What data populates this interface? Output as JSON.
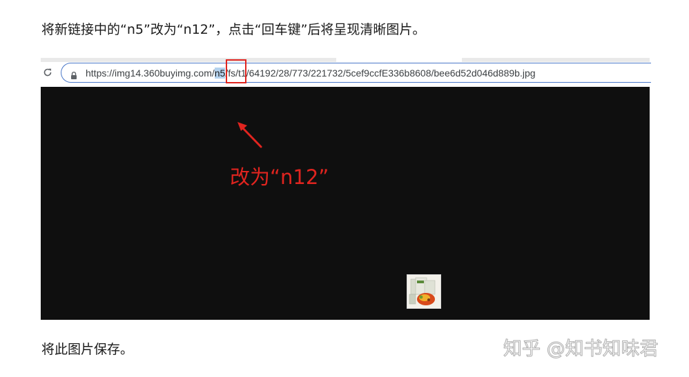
{
  "article": {
    "instruction_top": "将新链接中的“n5”改为“n12”，点击“回车键”后将呈现清晰图片。",
    "instruction_bottom": "将此图片保存。"
  },
  "browser": {
    "url_prefix": "https://img14.360buyimg.com/",
    "url_highlight": "n5",
    "url_suffix": "/fs/t1/64192/28/773/221732/5cef9ccfE336b8608/bee6d52d046d889b.jpg",
    "icons": [
      "reload-icon",
      "lock-icon"
    ]
  },
  "annotation": {
    "label": "改为“n12”",
    "color": "#e0241f"
  },
  "watermark": {
    "text": "知乎 @知书知味君"
  },
  "colors": {
    "viewport_background": "#0f0f0f",
    "omnibox_border": "#4a78c9",
    "selection_highlight": "#b4d2ee"
  }
}
